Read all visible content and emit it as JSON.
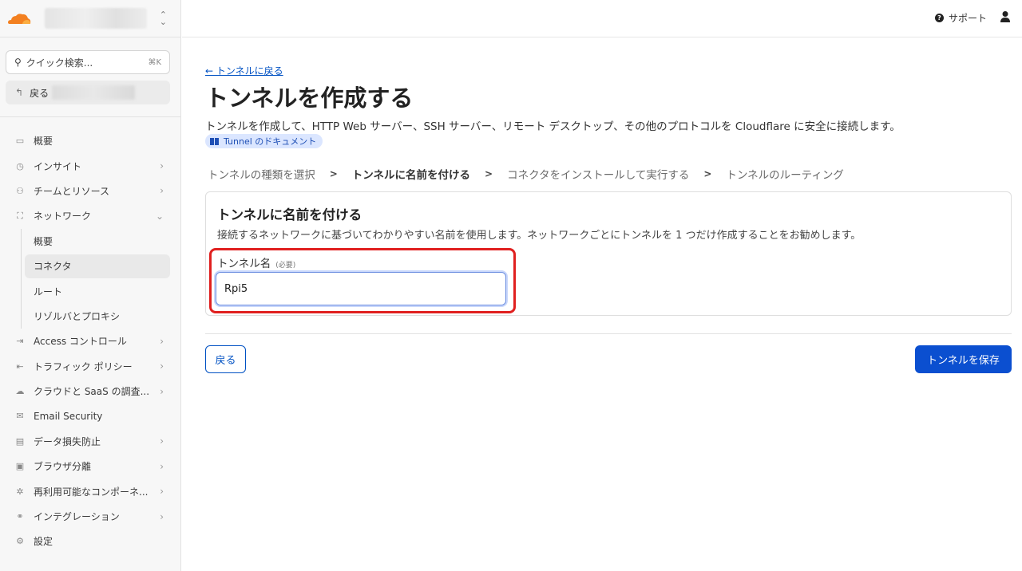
{
  "sidebar": {
    "quick_search": {
      "label": "クイック検索...",
      "shortcut": "⌘K"
    },
    "back_label": "戻る",
    "items": [
      {
        "label": "概要",
        "icon": "overview-icon"
      },
      {
        "label": "インサイト",
        "icon": "clock-icon",
        "chevron": "›"
      },
      {
        "label": "チームとリソース",
        "icon": "team-icon",
        "chevron": "›"
      },
      {
        "label": "ネットワーク",
        "icon": "network-icon",
        "chevron": "⌄"
      }
    ],
    "sub_items": [
      {
        "label": "概要"
      },
      {
        "label": "コネクタ",
        "active": true
      },
      {
        "label": "ルート"
      },
      {
        "label": "リゾルバとプロキシ"
      }
    ],
    "items2": [
      {
        "label": "Access コントロール",
        "icon": "access-icon",
        "chevron": "›"
      },
      {
        "label": "トラフィック ポリシー",
        "icon": "traffic-icon",
        "chevron": "›"
      },
      {
        "label": "クラウドと SaaS の調査...",
        "icon": "cloud-icon",
        "chevron": "›"
      },
      {
        "label": "Email Security",
        "icon": "email-icon"
      },
      {
        "label": "データ損失防止",
        "icon": "dlp-icon",
        "chevron": "›"
      },
      {
        "label": "ブラウザ分離",
        "icon": "browser-icon",
        "chevron": "›"
      },
      {
        "label": "再利用可能なコンポーネ...",
        "icon": "component-icon",
        "chevron": "›"
      },
      {
        "label": "インテグレーション",
        "icon": "integration-icon",
        "chevron": "›"
      },
      {
        "label": "設定",
        "icon": "gear-icon"
      }
    ]
  },
  "topbar": {
    "support_label": "サポート"
  },
  "main": {
    "back_link": "← トンネルに戻る",
    "title": "トンネルを作成する",
    "description": "トンネルを作成して、HTTP Web サーバー、SSH サーバー、リモート デスクトップ、その他のプロトコルを Cloudflare に安全に接続します。",
    "doc_badge": "Tunnel のドキュメント",
    "steps": [
      "トンネルの種類を選択",
      "トンネルに名前を付ける",
      "コネクタをインストールして実行する",
      "トンネルのルーティング"
    ],
    "step_separator": ">",
    "card": {
      "title": "トンネルに名前を付ける",
      "description": "接続するネットワークに基づいてわかりやすい名前を使用します。ネットワークごとにトンネルを 1 つだけ作成することをお勧めします。",
      "field_label": "トンネル名",
      "required": "(必要)",
      "field_value": "Rpi5"
    },
    "back_button": "戻る",
    "save_button": "トンネルを保存"
  },
  "colors": {
    "accent": "#0b4fd0",
    "link": "#0051c3",
    "highlight": "#e0201f",
    "logo": "#f38020"
  }
}
